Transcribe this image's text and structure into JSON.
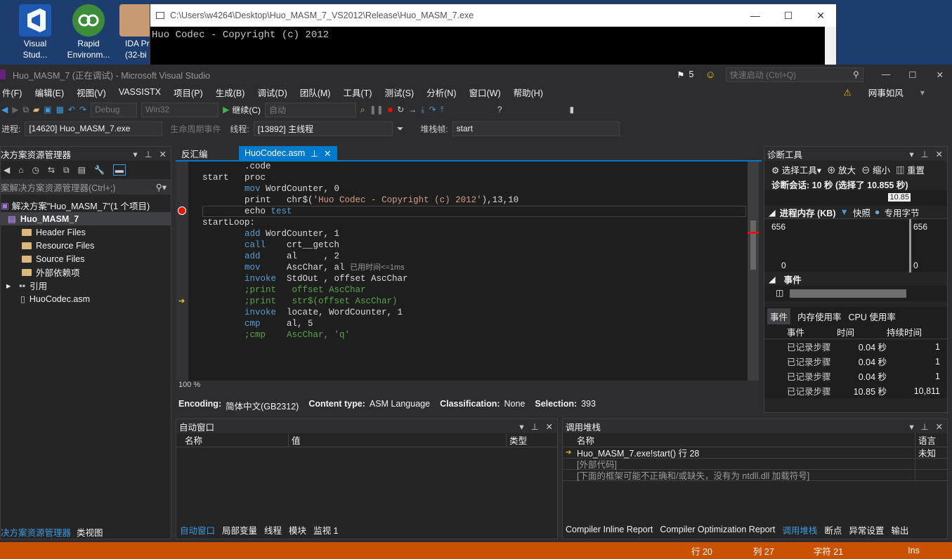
{
  "desktop": {
    "icons": [
      {
        "label": "Visual Stud..."
      },
      {
        "label": "Rapid Environm..."
      },
      {
        "label": "IDA Pr (32-bi"
      }
    ]
  },
  "console": {
    "title": "C:\\Users\\w4264\\Desktop\\Huo_MASM_7_VS2012\\Release\\Huo_MASM_7.exe",
    "output": "Huo Codec - Copyright (c) 2012"
  },
  "vs": {
    "title": "Huo_MASM_7 (正在调试) - Microsoft Visual Studio",
    "notify_count": "5",
    "quick_launch": "快速启动 (Ctrl+Q)",
    "user": "网事如风",
    "menu": [
      "件(F)",
      "编辑(E)",
      "视图(V)",
      "VASSISTX",
      "项目(P)",
      "生成(B)",
      "调试(D)",
      "团队(M)",
      "工具(T)",
      "测试(S)",
      "分析(N)",
      "窗口(W)",
      "帮助(H)"
    ],
    "toolbar": {
      "config": "Debug",
      "platform": "Win32",
      "continue": "继续(C)",
      "auto": "自动"
    },
    "debugbar": {
      "process_label": "进程:",
      "process": "[14620] Huo_MASM_7.exe",
      "lifecycle": "生命周期事件",
      "thread_label": "线程:",
      "thread": "[13892] 主线程",
      "stack_label": "堆栈帧:",
      "stack": "start"
    }
  },
  "solution": {
    "title": "决方案资源管理器",
    "search": "案解决方案资源管理器(Ctrl+;)",
    "root": "解决方案\"Huo_MASM_7\"(1 个项目)",
    "project": "Huo_MASM_7",
    "items": [
      "Header Files",
      "Resource Files",
      "Source Files",
      "外部依赖项",
      "引用",
      "HuoCodec.asm"
    ],
    "bottom_tabs": [
      "决方案资源管理器",
      "类视图"
    ]
  },
  "editor": {
    "tabs": [
      "反汇编",
      "HuoCodec.asm"
    ],
    "zoom": "100 %",
    "lines": [
      {
        "a": "        ",
        "k": "",
        "b": ".code",
        "c": ""
      },
      {
        "a": "",
        "k": "",
        "b": "",
        "c": ""
      },
      {
        "a": "start   proc",
        "k": "",
        "b": "",
        "c": ""
      },
      {
        "a": "",
        "k": "",
        "b": "",
        "c": ""
      },
      {
        "a": "        ",
        "k": "mov",
        "b": " WordCounter, 0",
        "c": ""
      },
      {
        "a": "        ",
        "k": "",
        "b": "print   chr$('Huo Codec - Copyright (c) 2012'),13,10",
        "c": ""
      },
      {
        "a": "        ",
        "k": "",
        "b": "echo ",
        "c": "test"
      },
      {
        "a": "",
        "k": "",
        "b": "",
        "c": ""
      },
      {
        "a": "startLoop:",
        "k": "",
        "b": "",
        "c": ""
      },
      {
        "a": "        ",
        "k": "add",
        "b": " WordCounter, 1",
        "c": ""
      },
      {
        "a": "        ",
        "k": "call",
        "b": "    crt__getch",
        "c": ""
      },
      {
        "a": "        ",
        "k": "add",
        "b": "     al     , 2",
        "c": ""
      },
      {
        "a": "        ",
        "k": "mov",
        "b": "     AscChar, al ",
        "c": "已用时间<=1ms"
      },
      {
        "a": "        ",
        "k": "invoke",
        "b": "  StdOut , offset AscChar",
        "c": ""
      },
      {
        "a": "        ",
        "k": "",
        "b": ";print   offset AscChar",
        "c": ""
      },
      {
        "a": "        ",
        "k": "",
        "b": ";print   str$(offset AscChar)",
        "c": ""
      },
      {
        "a": "",
        "k": "",
        "b": "",
        "c": ""
      },
      {
        "a": "        ",
        "k": "invoke",
        "b": "  locate, WordCounter, 1",
        "c": ""
      },
      {
        "a": "        ",
        "k": "cmp",
        "b": "     al, 5",
        "c": ""
      },
      {
        "a": "        ",
        "k": "",
        "b": ";cmp    AscChar, 'q'",
        "c": ""
      }
    ],
    "status": {
      "encoding_label": "Encoding:",
      "encoding": "简体中文(GB2312)",
      "ctype_label": "Content type:",
      "ctype": "ASM Language",
      "class_label": "Classification:",
      "class": "None",
      "sel_label": "Selection:",
      "sel": "393"
    }
  },
  "diag": {
    "title": "诊断工具",
    "select_tool": "选择工具▾",
    "zoom_in": "放大",
    "zoom_out": "缩小",
    "reset": "重置",
    "session": "诊断会话: 10 秒 (选择了 10.855 秒)",
    "time_marker": "10.85",
    "mem_title": "进程内存 (KB)",
    "snapshot": "快照",
    "private": "专用字节",
    "mem_max": "656",
    "mem_min": "0",
    "events_title": "事件",
    "tabs": [
      "事件",
      "内存使用率",
      "CPU 使用率"
    ],
    "cols": [
      "事件",
      "时间",
      "持续时间"
    ],
    "rows": [
      [
        "已记录步骤",
        "0.04 秒",
        "1"
      ],
      [
        "已记录步骤",
        "0.04 秒",
        "1"
      ],
      [
        "已记录步骤",
        "0.04 秒",
        "1"
      ],
      [
        "已记录步骤",
        "10.85 秒",
        "10,811"
      ]
    ]
  },
  "autos": {
    "title": "自动窗口",
    "cols": [
      "名称",
      "值",
      "类型"
    ],
    "tabs": [
      "自动窗口",
      "局部变量",
      "线程",
      "模块",
      "监视 1"
    ]
  },
  "callstack": {
    "title": "调用堆栈",
    "cols": [
      "名称",
      "语言"
    ],
    "rows": [
      [
        "Huo_MASM_7.exe!start() 行 28",
        "未知"
      ],
      [
        "[外部代码]",
        ""
      ],
      [
        "[下面的框架可能不正确和/或缺失，没有为 ntdll.dll 加载符号]",
        ""
      ]
    ],
    "tabs": [
      "Compiler Inline Report",
      "Compiler Optimization Report",
      "调用堆栈",
      "断点",
      "异常设置",
      "输出"
    ]
  },
  "statusbar": {
    "line": "行 20",
    "col": "列 27",
    "char": "字符 21",
    "mode": "Ins"
  }
}
